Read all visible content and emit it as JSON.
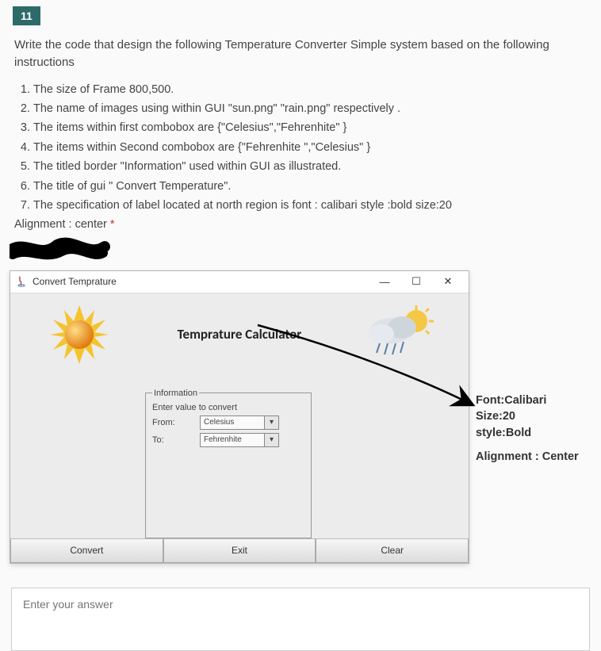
{
  "question": {
    "number": "11",
    "prompt": "Write the code that design the following Temperature Converter Simple system based on the following instructions",
    "items": [
      "The size of Frame 800,500.",
      "The name of images using within GUI \"sun.png\" \"rain.png\" respectively .",
      "The items within first combobox are {\"Celesius\",\"Fehrenhite\" }",
      "The items within Second combobox are {\"Fehrenhite \",\"Celesius\" }",
      "The titled border \"Information\" used within GUI as illustrated.",
      "The title of gui \" Convert Temperature\".",
      "The specification of label located at north region is font : calibari style :bold size:20"
    ],
    "align_note": "Alignment : center",
    "asterisk": "*"
  },
  "gui": {
    "title": "Convert Temprature",
    "heading_label": "Temprature Calculator",
    "fieldset": {
      "legend": "Information",
      "enter": "Enter value to convert",
      "from_label": "From:",
      "to_label": "To:",
      "combo1_value": "Celesius",
      "combo2_value": "Fehrenhite"
    },
    "buttons": {
      "convert": "Convert",
      "exit": "Exit",
      "clear": "Clear"
    }
  },
  "annotation": {
    "line1": "Font:Calibari",
    "line2": "Size:20",
    "line3": "style:Bold",
    "line4": "Alignment : Center"
  },
  "answer_placeholder": "Enter your answer"
}
